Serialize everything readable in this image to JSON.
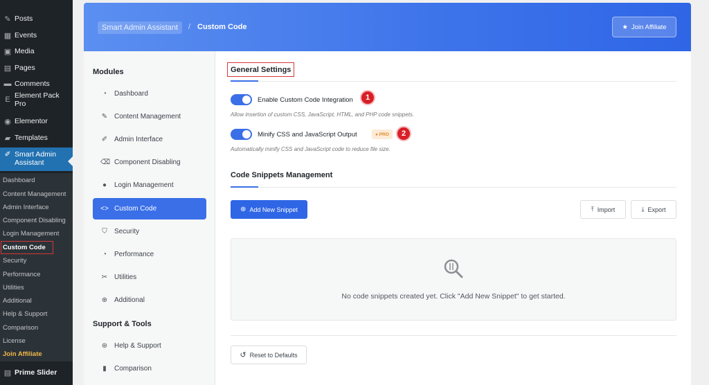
{
  "wp_menu": [
    {
      "label": "Posts",
      "icon": "pin-icon",
      "glyph": "✎"
    },
    {
      "label": "Events",
      "icon": "calendar-icon",
      "glyph": "▦"
    },
    {
      "label": "Media",
      "icon": "media-icon",
      "glyph": "▣"
    },
    {
      "label": "Pages",
      "icon": "page-icon",
      "glyph": "▤"
    },
    {
      "label": "Comments",
      "icon": "comment-icon",
      "glyph": "▬"
    },
    {
      "label": "Element Pack Pro",
      "icon": "element-pack-icon",
      "glyph": "E"
    },
    {
      "label": "Elementor",
      "icon": "elementor-icon",
      "glyph": "◉"
    },
    {
      "label": "Templates",
      "icon": "folder-icon",
      "glyph": "▰"
    }
  ],
  "wp_active": {
    "label_line1": "Smart Admin",
    "label_line2": "Assistant",
    "icon": "wrench-icon"
  },
  "wp_submenu": [
    "Dashboard",
    "Content Management",
    "Admin Interface",
    "Component Disabling",
    "Login Management",
    "Custom Code",
    "Security",
    "Performance",
    "Utilities",
    "Additional",
    "Help & Support",
    "Comparison",
    "License",
    "Join Affiliate"
  ],
  "wp_bottom": {
    "label": "Prime Slider",
    "icon": "slider-icon"
  },
  "header": {
    "breadcrumb_parent": "Smart Admin Assistant",
    "breadcrumb_sep": "/",
    "breadcrumb_current": "Custom Code",
    "join_label": "Join Affiliate"
  },
  "modnav": {
    "modules_heading": "Modules",
    "modules": [
      {
        "label": "Dashboard",
        "icon": "gauge-icon",
        "glyph": "◔"
      },
      {
        "label": "Content Management",
        "icon": "pin-icon",
        "glyph": "✎"
      },
      {
        "label": "Admin Interface",
        "icon": "brush-icon",
        "glyph": "✐"
      },
      {
        "label": "Component Disabling",
        "icon": "eraser-icon",
        "glyph": "⌫"
      },
      {
        "label": "Login Management",
        "icon": "user-icon",
        "glyph": "●"
      },
      {
        "label": "Custom Code",
        "icon": "code-icon",
        "glyph": "<>"
      },
      {
        "label": "Security",
        "icon": "shield-icon",
        "glyph": "⛉"
      },
      {
        "label": "Performance",
        "icon": "gauge-icon",
        "glyph": "◔"
      },
      {
        "label": "Utilities",
        "icon": "wrench-icon",
        "glyph": "✂"
      },
      {
        "label": "Additional",
        "icon": "plus-circle-icon",
        "glyph": "⊕"
      }
    ],
    "support_heading": "Support & Tools",
    "support": [
      {
        "label": "Help & Support",
        "icon": "lifebuoy-icon",
        "glyph": "⊛"
      },
      {
        "label": "Comparison",
        "icon": "bar-chart-icon",
        "glyph": "▮"
      }
    ]
  },
  "general": {
    "title": "General Settings",
    "opt1_label": "Enable Custom Code Integration",
    "opt1_desc": "Allow insertion of custom CSS, JavaScript, HTML, and PHP code snippets.",
    "opt1_enabled": true,
    "opt2_label": "Minify CSS and JavaScript Output",
    "opt2_desc": "Automatically minify CSS and JavaScript code to reduce file size.",
    "opt2_enabled": true,
    "pro_badge": "● PRO",
    "step1": "1",
    "step2": "2"
  },
  "snippets": {
    "title": "Code Snippets Management",
    "add_label": "Add New Snippet",
    "import_label": "Import",
    "export_label": "Export",
    "empty_text": "No code snippets created yet. Click \"Add New Snippet\" to get started."
  },
  "reset_label": "Reset to Defaults",
  "colors": {
    "accent": "#3a6fe8",
    "wp_active": "#2271b1",
    "highlight": "#d63638",
    "affiliate": "#f0b849"
  }
}
